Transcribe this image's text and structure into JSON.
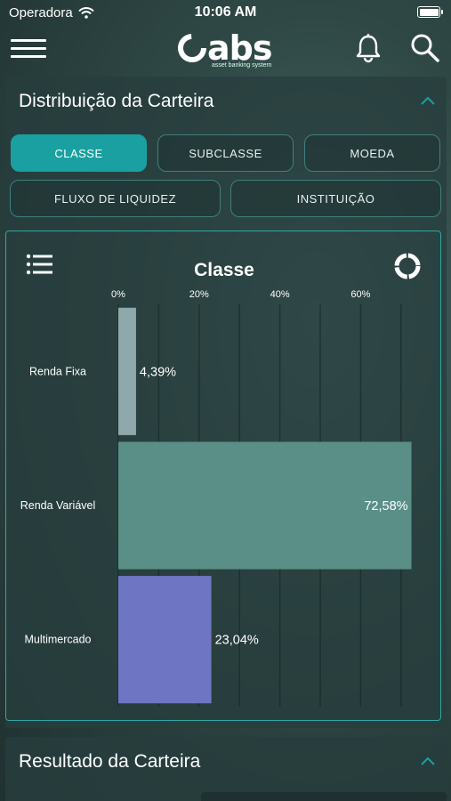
{
  "status_bar": {
    "carrier": "Operadora",
    "time": "10:06 AM"
  },
  "header": {
    "logo_text": "abs",
    "logo_subtitle": "asset banking system"
  },
  "distribution": {
    "title": "Distribuição da Carteira",
    "filters": [
      {
        "label": "CLASSE",
        "active": true
      },
      {
        "label": "SUBCLASSE",
        "active": false
      },
      {
        "label": "MOEDA",
        "active": false
      },
      {
        "label": "FLUXO DE LIQUIDEZ",
        "active": false
      },
      {
        "label": "INSTITUIÇÃO",
        "active": false
      }
    ]
  },
  "chart_data": {
    "type": "bar",
    "orientation": "horizontal",
    "title": "Classe",
    "categories": [
      "Renda Fixa",
      "Renda Variável",
      "Multimercado"
    ],
    "values": [
      4.39,
      72.58,
      23.04
    ],
    "value_labels": [
      "4,39%",
      "72,58%",
      "23,04%"
    ],
    "colors": [
      "#8ea8ab",
      "#5a8f88",
      "#6e76c4"
    ],
    "x_ticks": [
      "0%",
      "20%",
      "40%",
      "60%"
    ],
    "x_tick_values": [
      0,
      20,
      40,
      60
    ],
    "xlim": [
      0,
      74
    ],
    "grid": true,
    "axis_position": "top"
  },
  "result": {
    "title": "Resultado da Carteira"
  },
  "colors": {
    "accent": "#1aa0a0",
    "panel_border": "#2fa7a4"
  }
}
